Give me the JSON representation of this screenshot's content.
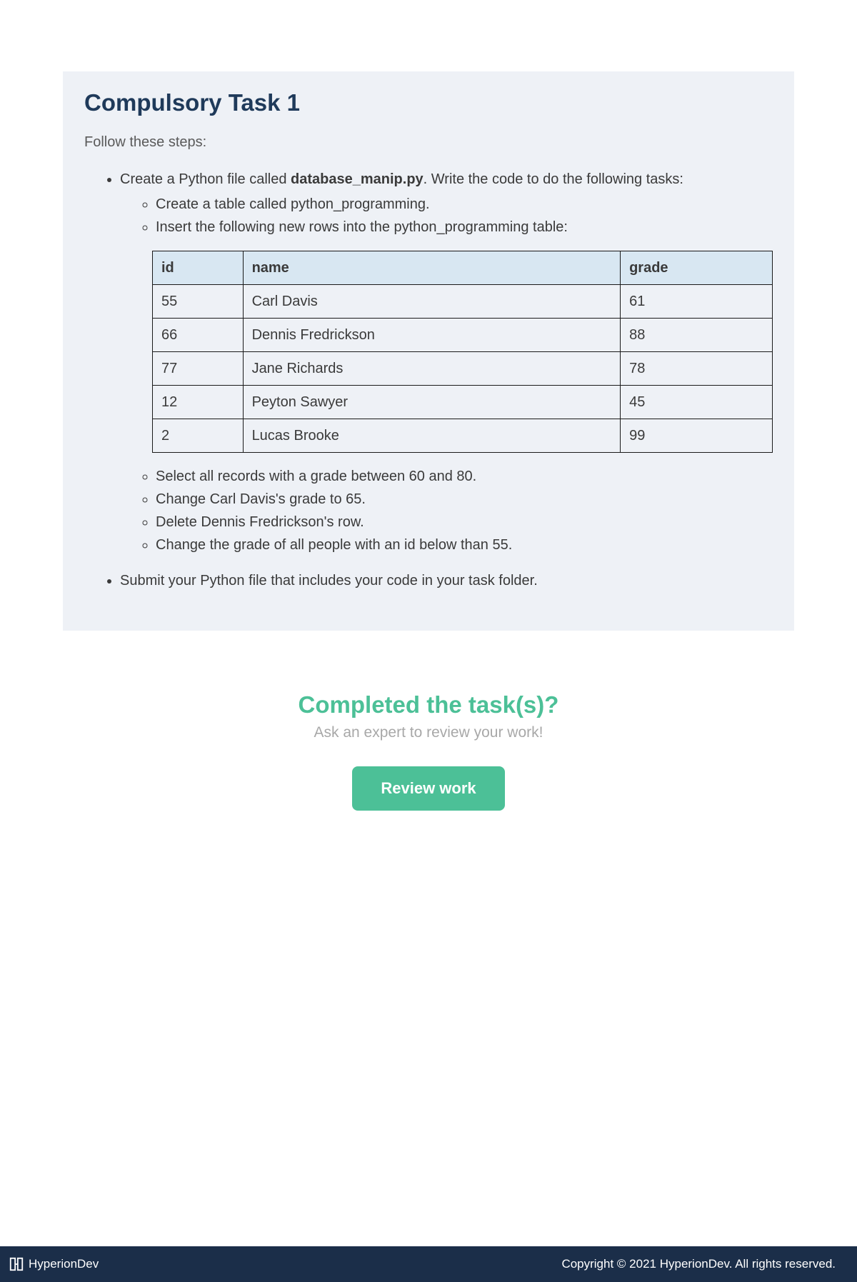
{
  "task": {
    "title": "Compulsory Task 1",
    "follow": "Follow these steps:",
    "step1_pre": "Create a Python file called ",
    "step1_bold": "database_manip.py",
    "step1_post": ". Write the code to do the following tasks:",
    "sub1": "Create a table called python_programming.",
    "sub2": "Insert the following new rows into the python_programming table:",
    "sub3": "Select all records with a grade between 60 and 80.",
    "sub4": "Change Carl Davis's grade to 65.",
    "sub5": "Delete Dennis Fredrickson's row.",
    "sub6": "Change the grade of all people with an id below than 55.",
    "step2": "Submit your Python file that includes your code in your task folder."
  },
  "table": {
    "headers": [
      "id",
      "name",
      "grade"
    ],
    "rows": [
      [
        "55",
        "Carl Davis",
        "61"
      ],
      [
        "66",
        "Dennis Fredrickson",
        "88"
      ],
      [
        "77",
        "Jane Richards",
        "78"
      ],
      [
        "12",
        "Peyton Sawyer",
        "45"
      ],
      [
        "2",
        "Lucas Brooke",
        "99"
      ]
    ]
  },
  "completed": {
    "title": "Completed the task(s)?",
    "subtitle": "Ask an expert to review your work!",
    "button": "Review work"
  },
  "footer": {
    "brand": "HyperionDev",
    "copyright": "Copyright © 2021 HyperionDev. All rights reserved."
  }
}
